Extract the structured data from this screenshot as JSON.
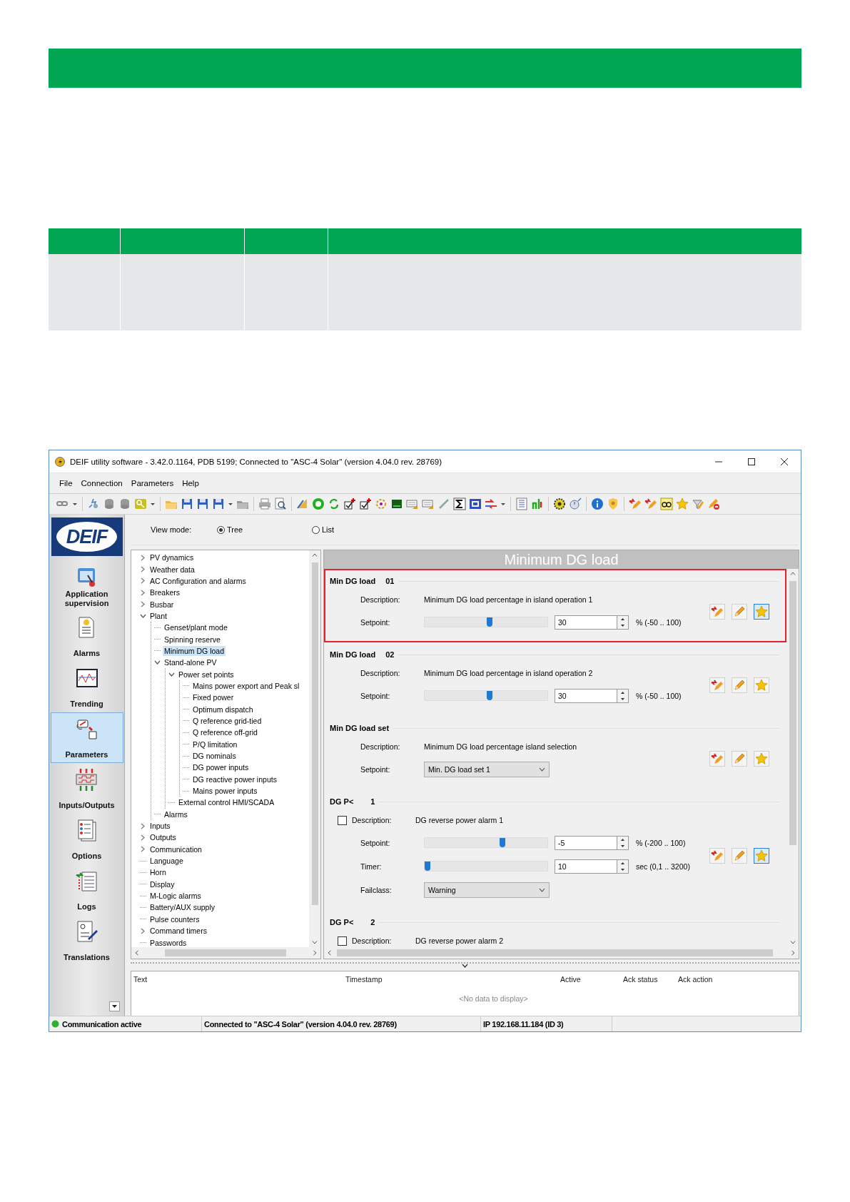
{
  "window": {
    "title": "DEIF utility software - 3.42.0.1164, PDB 5199; Connected to \"ASC-4 Solar\" (version 4.04.0 rev. 28769)"
  },
  "menu": [
    "File",
    "Connection",
    "Parameters",
    "Help"
  ],
  "sidebar": {
    "logo": "DEIF",
    "items": [
      {
        "label": "Application supervision",
        "selected": false
      },
      {
        "label": "Alarms",
        "selected": false
      },
      {
        "label": "Trending",
        "selected": false
      },
      {
        "label": "Parameters",
        "selected": true
      },
      {
        "label": "Inputs/Outputs",
        "selected": false
      },
      {
        "label": "Options",
        "selected": false
      },
      {
        "label": "Logs",
        "selected": false
      },
      {
        "label": "Translations",
        "selected": false
      }
    ]
  },
  "view_mode": {
    "label": "View mode:",
    "options": [
      {
        "label": "Tree",
        "selected": true
      },
      {
        "label": "List",
        "selected": false
      }
    ]
  },
  "tree": [
    {
      "label": "PV dynamics",
      "expanded": false,
      "selected": false
    },
    {
      "label": "Weather data",
      "expanded": false,
      "selected": false
    },
    {
      "label": "AC Configuration and alarms",
      "expanded": false,
      "selected": false
    },
    {
      "label": "Breakers",
      "expanded": false,
      "selected": false
    },
    {
      "label": "Busbar",
      "expanded": false,
      "selected": false
    },
    {
      "label": "Plant",
      "expanded": true,
      "selected": false,
      "children": [
        {
          "label": "Genset/plant mode",
          "selected": false
        },
        {
          "label": "Spinning reserve",
          "selected": false
        },
        {
          "label": "Minimum DG load",
          "selected": true
        },
        {
          "label": "Stand-alone PV",
          "expanded": true,
          "selected": false,
          "children": [
            {
              "label": "Power set points",
              "expanded": true,
              "selected": false,
              "children": [
                {
                  "label": "Mains power export and Peak sl",
                  "selected": false
                },
                {
                  "label": "Fixed power",
                  "selected": false
                },
                {
                  "label": "Optimum dispatch",
                  "selected": false
                },
                {
                  "label": "Q reference grid-tied",
                  "selected": false
                },
                {
                  "label": "Q reference off-grid",
                  "selected": false
                },
                {
                  "label": "P/Q limitation",
                  "selected": false
                },
                {
                  "label": "DG nominals",
                  "selected": false
                },
                {
                  "label": "DG power inputs",
                  "selected": false
                },
                {
                  "label": "DG reactive power inputs",
                  "selected": false
                },
                {
                  "label": "Mains power inputs",
                  "selected": false
                }
              ]
            },
            {
              "label": "External control HMI/SCADA",
              "selected": false
            }
          ]
        },
        {
          "label": "Alarms",
          "selected": false
        }
      ]
    },
    {
      "label": "Inputs",
      "expanded": false,
      "selected": false
    },
    {
      "label": "Outputs",
      "expanded": false,
      "selected": false
    },
    {
      "label": "Communication",
      "expanded": false,
      "selected": false
    },
    {
      "label": "Language",
      "selected": false
    },
    {
      "label": "Horn",
      "selected": false
    },
    {
      "label": "Display",
      "selected": false
    },
    {
      "label": "M-Logic alarms",
      "selected": false
    },
    {
      "label": "Battery/AUX supply",
      "selected": false
    },
    {
      "label": "Pulse counters",
      "selected": false
    },
    {
      "label": "Command timers",
      "expanded": false,
      "selected": false
    },
    {
      "label": "Passwords",
      "selected": false
    }
  ],
  "panel": {
    "title": "Minimum DG load",
    "groups": [
      {
        "title": "Min DG load",
        "number": "01",
        "highlighted": true,
        "favorite": true,
        "description_label": "Description:",
        "description": "Minimum DG load percentage in island operation 1",
        "rows": [
          {
            "kind": "slider",
            "label": "Setpoint:",
            "level": 0.53,
            "value": "30",
            "unit": "% (-50 .. 100)"
          }
        ]
      },
      {
        "title": "Min DG load",
        "number": "02",
        "highlighted": false,
        "favorite": false,
        "description_label": "Description:",
        "description": "Minimum DG load percentage in island operation 2",
        "rows": [
          {
            "kind": "slider",
            "label": "Setpoint:",
            "level": 0.53,
            "value": "30",
            "unit": "% (-50 .. 100)"
          }
        ]
      },
      {
        "title": "Min DG load set",
        "highlighted": false,
        "favorite": false,
        "description_label": "Description:",
        "description": "Minimum DG load percentage island selection",
        "rows": [
          {
            "kind": "dropdown",
            "label": "Setpoint:",
            "value": "Min. DG load set 1"
          }
        ]
      },
      {
        "title": "DG P<",
        "number": "1",
        "highlighted": false,
        "favorite": true,
        "checked": false,
        "description_label": "Description:",
        "description": "DG reverse power alarm 1",
        "rows": [
          {
            "kind": "slider",
            "label": "Setpoint:",
            "level": 0.64,
            "value": "-5",
            "unit": "% (-200 .. 100)"
          },
          {
            "kind": "slider",
            "label": "Timer:",
            "level": 0.0,
            "value": "10",
            "unit": "sec (0,1 .. 3200)"
          },
          {
            "kind": "dropdown",
            "label": "Failclass:",
            "value": "Warning"
          }
        ]
      },
      {
        "title": "DG P<",
        "number": "2",
        "highlighted": false,
        "checked": false,
        "description_label": "Description:",
        "description": "DG reverse power alarm 2"
      }
    ]
  },
  "log": {
    "columns": [
      "Text",
      "Timestamp",
      "Active",
      "Ack status",
      "Ack action"
    ],
    "empty_text": "<No data to display>"
  },
  "status_bar": [
    "Communication active",
    "Connected to \"ASC-4 Solar\" (version 4.04.0 rev. 28769)",
    "IP 192.168.11.184 (ID 3)"
  ]
}
